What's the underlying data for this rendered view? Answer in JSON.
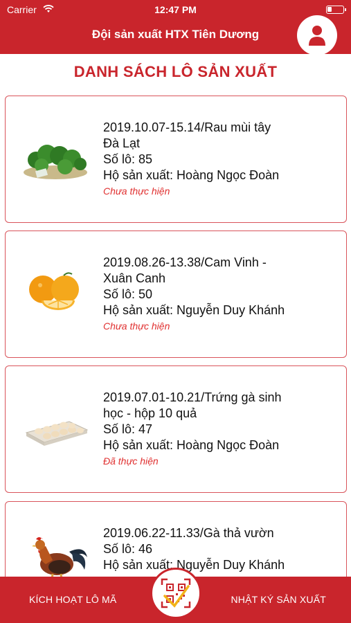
{
  "status_bar": {
    "carrier": "Carrier",
    "time": "12:47 PM"
  },
  "header": {
    "title": "Đội sản xuất HTX Tiên Dương"
  },
  "page_title": "DANH SÁCH LÔ SẢN XUẤT",
  "batches": [
    {
      "line1": "2019.10.07-15.14/Rau mùi tây",
      "line2": "Đà Lạt",
      "lot": "Số lô: 85",
      "producer": "Hộ sản xuất: Hoàng Ngọc Đoàn",
      "status": "Chưa thực hiện",
      "image": "parsley-icon"
    },
    {
      "line1": "2019.08.26-13.38/Cam Vinh -",
      "line2": "Xuân Canh",
      "lot": "Số lô: 50",
      "producer": "Hộ sản xuất: Nguyễn Duy Khánh",
      "status": "Chưa thực hiện",
      "image": "orange-icon"
    },
    {
      "line1": "2019.07.01-10.21/Trứng gà sinh",
      "line2": "học - hộp 10 quả",
      "lot": "Số lô: 47",
      "producer": "Hộ sản xuất: Hoàng Ngọc Đoàn",
      "status": "Đã thực hiện",
      "image": "egg-tray-icon"
    },
    {
      "line1": "2019.06.22-11.33/Gà thả vườn",
      "line2": "",
      "lot": "Số lô: 46",
      "producer": "Hộ sản xuất: Nguyễn Duy Khánh",
      "status": "",
      "image": "rooster-icon"
    }
  ],
  "bottom_bar": {
    "left_label": "KÍCH HOẠT LÔ MÃ",
    "right_label": "NHẬT KÝ SẢN XUẤT"
  },
  "colors": {
    "primary": "#c9252c",
    "status": "#e03030"
  }
}
